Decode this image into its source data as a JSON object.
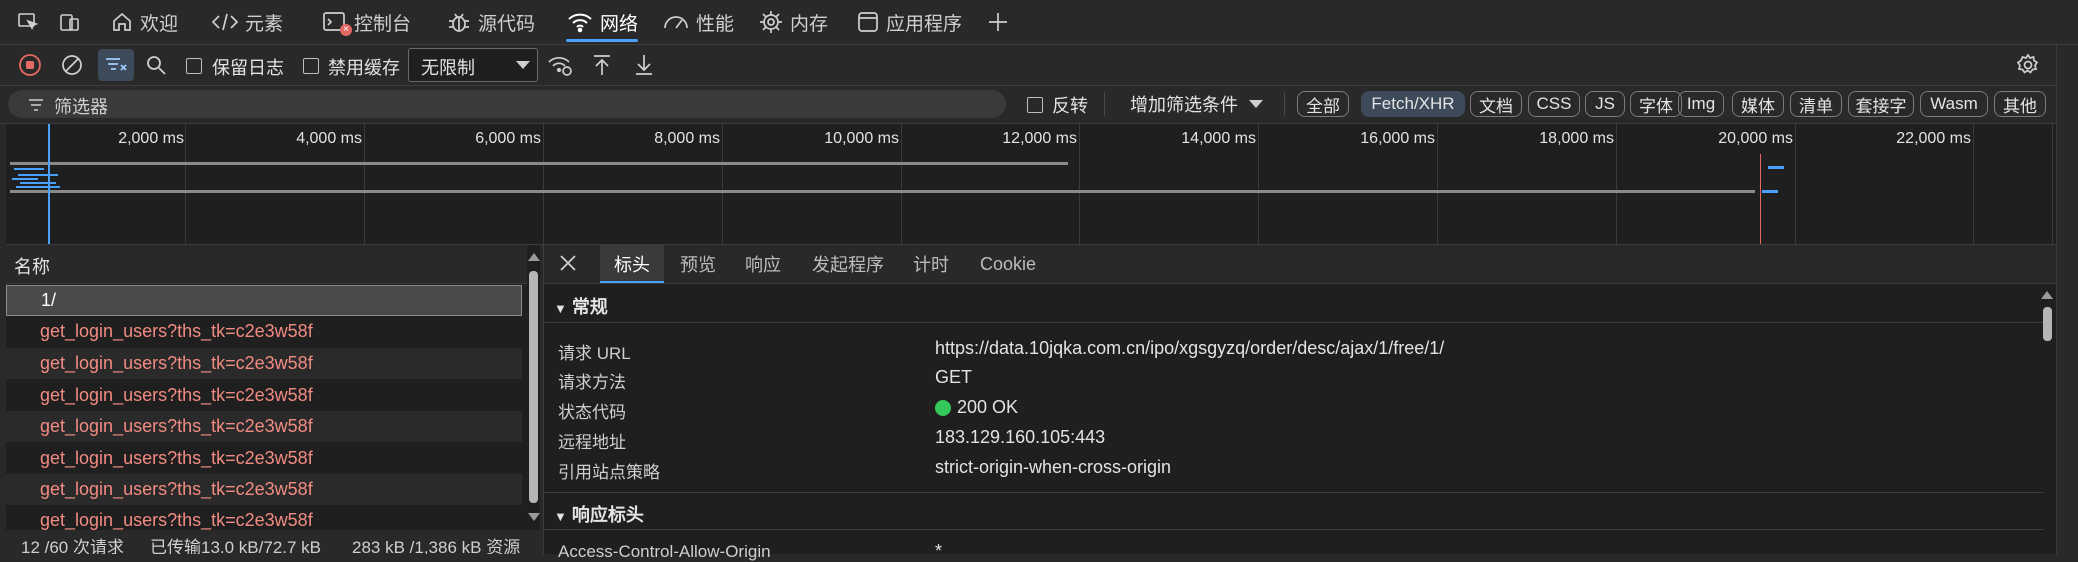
{
  "tabs": [
    {
      "label": "欢迎",
      "icon": "home-icon"
    },
    {
      "label": "元素",
      "icon": "code-icon"
    },
    {
      "label": "控制台",
      "icon": "console-icon"
    },
    {
      "label": "源代码",
      "icon": "bug-icon"
    },
    {
      "label": "网络",
      "icon": "wifi-icon",
      "active": true
    },
    {
      "label": "性能",
      "icon": "gauge-icon"
    },
    {
      "label": "内存",
      "icon": "memory-icon"
    },
    {
      "label": "应用程序",
      "icon": "app-icon"
    }
  ],
  "toolbar": {
    "preserve_log": "保留日志",
    "disable_cache": "禁用缓存",
    "throttling": "无限制"
  },
  "filter": {
    "placeholder": "筛选器",
    "invert": "反转",
    "more_filters": "增加筛选条件",
    "types": [
      "全部",
      "Fetch/XHR",
      "文档",
      "CSS",
      "JS",
      "字体",
      "Img",
      "媒体",
      "清单",
      "套接字",
      "Wasm",
      "其他"
    ],
    "active_type": "Fetch/XHR"
  },
  "timeline": {
    "ticks": [
      "2,000 ms",
      "4,000 ms",
      "6,000 ms",
      "8,000 ms",
      "10,000 ms",
      "12,000 ms",
      "14,000 ms",
      "16,000 ms",
      "18,000 ms",
      "20,000 ms",
      "22,000 ms"
    ]
  },
  "request_list": {
    "header": "名称",
    "rows": [
      "1/",
      "get_login_users?ths_tk=c2e3w58f",
      "get_login_users?ths_tk=c2e3w58f",
      "get_login_users?ths_tk=c2e3w58f",
      "get_login_users?ths_tk=c2e3w58f",
      "get_login_users?ths_tk=c2e3w58f",
      "get_login_users?ths_tk=c2e3w58f",
      "get_login_users?ths_tk=c2e3w58f"
    ]
  },
  "status_bar": {
    "requests": "12 /60 次请求",
    "transferred": "已传输13.0 kB/72.7 kB",
    "resources": "283 kB /1,386 kB 资源"
  },
  "details": {
    "tabs": [
      "标头",
      "预览",
      "响应",
      "发起程序",
      "计时",
      "Cookie"
    ],
    "active_tab": "标头",
    "general_title": "常规",
    "general": [
      {
        "key": "请求 URL",
        "value": "https://data.10jqka.com.cn/ipo/xgsgyzq/order/desc/ajax/1/free/1/"
      },
      {
        "key": "请求方法",
        "value": "GET"
      },
      {
        "key": "状态代码",
        "value": "200 OK"
      },
      {
        "key": "远程地址",
        "value": "183.129.160.105:443"
      },
      {
        "key": "引用站点策略",
        "value": "strict-origin-when-cross-origin"
      }
    ],
    "response_headers_title": "响应标头",
    "partial_header_key": "Access-Control-Allow-Origin",
    "partial_header_value": "*"
  },
  "colors": {
    "accent": "#4aa0ff",
    "error_text": "#f28b82",
    "status_ok": "#34c759",
    "record_red": "#e46962"
  }
}
